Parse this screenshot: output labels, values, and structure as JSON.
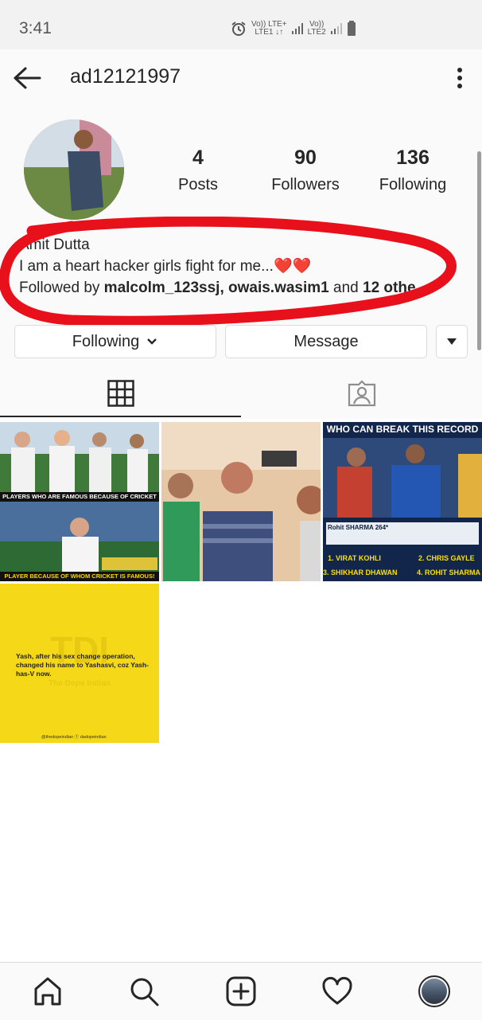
{
  "status_bar": {
    "time": "3:41",
    "net1": "Vo)) LTE+",
    "net1_sub": "LTE1 ↓↑",
    "net2": "Vo))",
    "net2_sub": "LTE2",
    "icons": [
      "alarm-icon",
      "signal-icon",
      "battery-icon"
    ]
  },
  "header": {
    "username": "ad12121997",
    "icons": [
      "back-arrow-icon",
      "more-vert-icon"
    ]
  },
  "profile": {
    "stats": [
      {
        "value": "4",
        "label": "Posts"
      },
      {
        "value": "90",
        "label": "Followers"
      },
      {
        "value": "136",
        "label": "Following"
      }
    ],
    "name": "Amit Dutta",
    "bio": "I am a heart hacker girls fight for me...",
    "bio_emoji": "❤️❤️",
    "followed_by_prefix": "Followed by",
    "followed_by_users": "malcolm_123ssj, owais.wasim1",
    "followed_by_and": "and",
    "followed_by_more": "12 othe",
    "annotation_color": "#e8101a"
  },
  "actions": {
    "following_label": "Following",
    "message_label": "Message"
  },
  "tabs": [
    "grid-icon",
    "tagged-icon"
  ],
  "posts": [
    {
      "top_caption": "PLAYERS WHO ARE FAMOUS BECAUSE OF CRICKET",
      "bottom_caption": "PLAYER BECAUSE OF WHOM CRICKET IS FAMOUS!"
    },
    {
      "caption": ""
    },
    {
      "title": "WHO CAN BREAK THIS RECORD",
      "scorebar": "Rohit SHARMA 264*",
      "options": [
        "1. VIRAT KOHLI",
        "2. CHRIS GAYLE",
        "3. SHIKHAR DHAWAN",
        "4. ROHIT SHARMA"
      ]
    },
    {
      "text": "Yash, after his sex change operation, changed his name to Yashasvi, coz Yash-has-V now.",
      "watermark": "TDI",
      "watermark_sub": "The Dope Indian",
      "handles": "@thedopeindian   ⓕ dadopeindian"
    }
  ],
  "colors": {
    "accent": "#262626",
    "post4_bg": "#f5d817",
    "annotation": "#e8101a"
  },
  "bottom_nav": [
    "home-icon",
    "search-icon",
    "add-post-icon",
    "heart-icon",
    "profile-avatar"
  ]
}
